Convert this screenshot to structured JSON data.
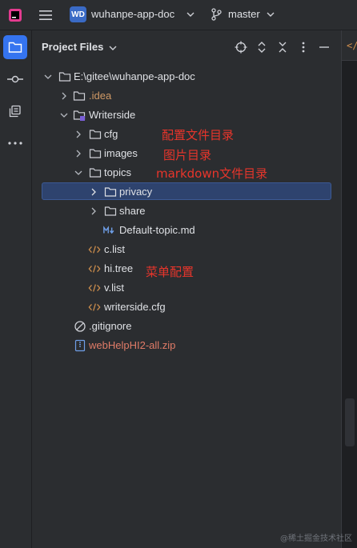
{
  "titlebar": {
    "project_badge": "WD",
    "project_name": "wuhanpe-app-doc",
    "branch": "master"
  },
  "toolstrip": {
    "items": [
      "project-files",
      "commit",
      "structure",
      "more"
    ]
  },
  "panel": {
    "title": "Project Files",
    "header_icons": [
      "crosshair-icon",
      "expand-all-icon",
      "collapse-all-icon",
      "more-vertical-icon",
      "minimize-icon"
    ]
  },
  "tree": {
    "root": "E:\\gitee\\wuhanpe-app-doc",
    "idea": ".idea",
    "writerside": "Writerside",
    "cfg": "cfg",
    "images": "images",
    "topics": "topics",
    "privacy": "privacy",
    "share": "share",
    "default_topic": "Default-topic.md",
    "c_list": "c.list",
    "hi_tree": "hi.tree",
    "v_list": "v.list",
    "writerside_cfg": "writerside.cfg",
    "gitignore": ".gitignore",
    "zip": "webHelpHI2-all.zip"
  },
  "annotations": {
    "cfg_note": "配置文件目录",
    "images_note": "图片目录",
    "topics_note": "markdown文件目录",
    "hi_tree_note": "菜单配置"
  },
  "editor": {
    "tab_code": "</"
  },
  "watermark": "@稀土掘金技术社区",
  "colors": {
    "background": "#1e1f22",
    "panel": "#2b2d30",
    "selection": "#2e436e",
    "accent": "#3574f0",
    "note_red": "#e8352b",
    "ignored_orange": "#d19a66",
    "xml_orange": "#ce8e4c"
  }
}
